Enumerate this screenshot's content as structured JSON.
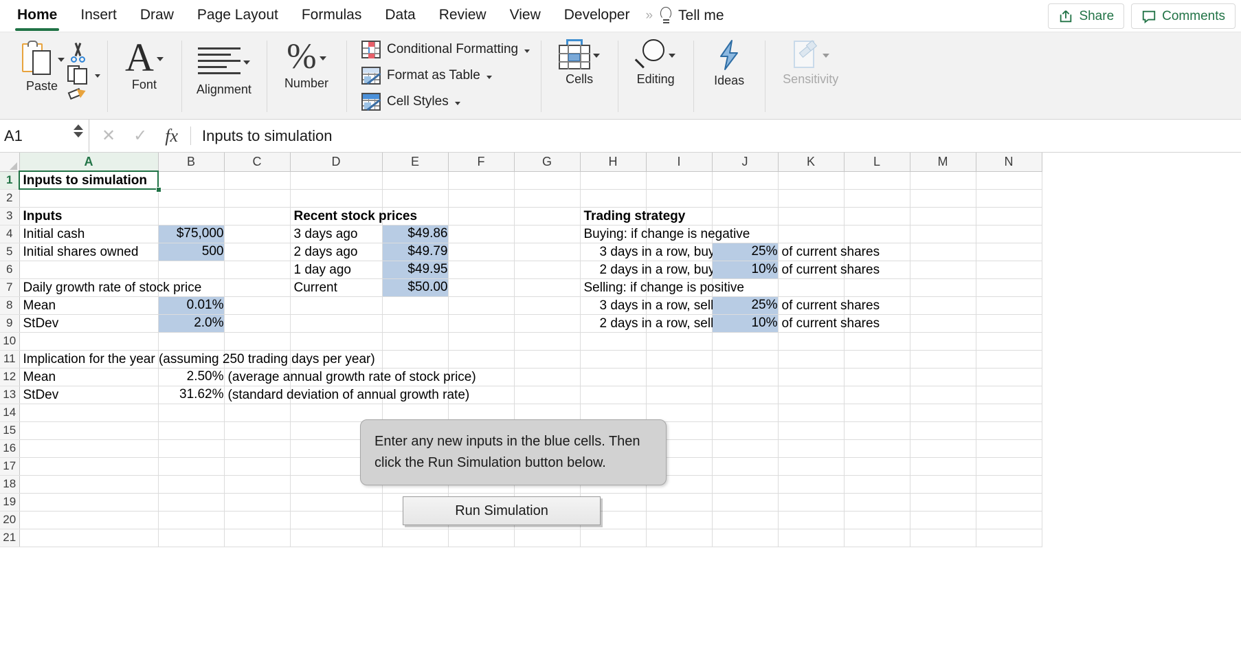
{
  "ribbon": {
    "tabs": [
      {
        "label": "Home",
        "active": true
      },
      {
        "label": "Insert",
        "active": false
      },
      {
        "label": "Draw",
        "active": false
      },
      {
        "label": "Page Layout",
        "active": false
      },
      {
        "label": "Formulas",
        "active": false
      },
      {
        "label": "Data",
        "active": false
      },
      {
        "label": "Review",
        "active": false
      },
      {
        "label": "View",
        "active": false
      },
      {
        "label": "Developer",
        "active": false
      }
    ],
    "overflow_chevron": "»",
    "tell_me": "Tell me",
    "share": "Share",
    "comments": "Comments",
    "groups": {
      "paste": "Paste",
      "font": "Font",
      "alignment": "Alignment",
      "number": "Number",
      "conditional_formatting": "Conditional Formatting",
      "format_as_table": "Format as Table",
      "cell_styles": "Cell Styles",
      "cells": "Cells",
      "editing": "Editing",
      "ideas": "Ideas",
      "sensitivity": "Sensitivity"
    }
  },
  "formula_bar": {
    "name_box": "A1",
    "formula": "Inputs to simulation",
    "cancel_icon": "✕",
    "enter_icon": "✓",
    "fx_icon": "fx"
  },
  "grid": {
    "columns": [
      "A",
      "B",
      "C",
      "D",
      "E",
      "F",
      "G",
      "H",
      "I",
      "J",
      "K",
      "L",
      "M",
      "N"
    ],
    "selected_column": "A",
    "selected_row": 1,
    "rows": [
      1,
      2,
      3,
      4,
      5,
      6,
      7,
      8,
      9,
      10,
      11,
      12,
      13,
      14,
      15,
      16,
      17,
      18,
      19,
      20,
      21
    ],
    "cells": {
      "A1": {
        "v": "Inputs to simulation",
        "bold": true
      },
      "A3": {
        "v": "Inputs",
        "bold": true
      },
      "A4": {
        "v": "Initial cash"
      },
      "B4": {
        "v": "$75,000",
        "align": "right",
        "fill": "blue"
      },
      "A5": {
        "v": "Initial shares owned"
      },
      "B5": {
        "v": "500",
        "align": "right",
        "fill": "blue"
      },
      "A7": {
        "v": "Daily growth rate of stock price"
      },
      "A8": {
        "v": "Mean"
      },
      "B8": {
        "v": "0.01%",
        "align": "right",
        "fill": "blue"
      },
      "A9": {
        "v": "StDev"
      },
      "B9": {
        "v": "2.0%",
        "align": "right",
        "fill": "blue"
      },
      "A11": {
        "v": "Implication for the year (assuming 250 trading days per year)"
      },
      "A12": {
        "v": "Mean"
      },
      "B12": {
        "v": "2.50%",
        "align": "right"
      },
      "C12": {
        "v": "(average annual growth rate of stock price)"
      },
      "A13": {
        "v": "StDev"
      },
      "B13": {
        "v": "31.62%",
        "align": "right"
      },
      "C13": {
        "v": "(standard deviation of annual growth rate)"
      },
      "D3": {
        "v": "Recent stock prices",
        "bold": true
      },
      "D4": {
        "v": "3 days ago"
      },
      "E4": {
        "v": "$49.86",
        "align": "right",
        "fill": "blue"
      },
      "D5": {
        "v": "2 days ago"
      },
      "E5": {
        "v": "$49.79",
        "align": "right",
        "fill": "blue"
      },
      "D6": {
        "v": "1 day ago"
      },
      "E6": {
        "v": "$49.95",
        "align": "right",
        "fill": "blue"
      },
      "D7": {
        "v": "Current"
      },
      "E7": {
        "v": "$50.00",
        "align": "right",
        "fill": "blue"
      },
      "H3": {
        "v": "Trading strategy",
        "bold": true
      },
      "H4": {
        "v": "Buying: if change is negative"
      },
      "H5": {
        "v": "3 days in a row, buy",
        "indent": true
      },
      "J5": {
        "v": "25%",
        "align": "right",
        "fill": "blue"
      },
      "K5": {
        "v": "of current shares"
      },
      "H6": {
        "v": "2 days in a row, buy",
        "indent": true
      },
      "J6": {
        "v": "10%",
        "align": "right",
        "fill": "blue"
      },
      "K6": {
        "v": "of current shares"
      },
      "H7": {
        "v": "Selling: if change is positive"
      },
      "H8": {
        "v": "3 days in a row, sell",
        "indent": true
      },
      "J8": {
        "v": "25%",
        "align": "right",
        "fill": "blue"
      },
      "K8": {
        "v": "of current shares"
      },
      "H9": {
        "v": "2 days in a row, sell",
        "indent": true
      },
      "J9": {
        "v": "10%",
        "align": "right",
        "fill": "blue"
      },
      "K9": {
        "v": "of current shares"
      }
    }
  },
  "callout": {
    "text": "Enter any new inputs in the blue cells. Then click the Run Simulation button below."
  },
  "run_button": {
    "label": "Run Simulation"
  },
  "colors": {
    "accent_green": "#217346",
    "input_blue": "#b8cce4",
    "callout_gray": "#d2d2d2"
  }
}
